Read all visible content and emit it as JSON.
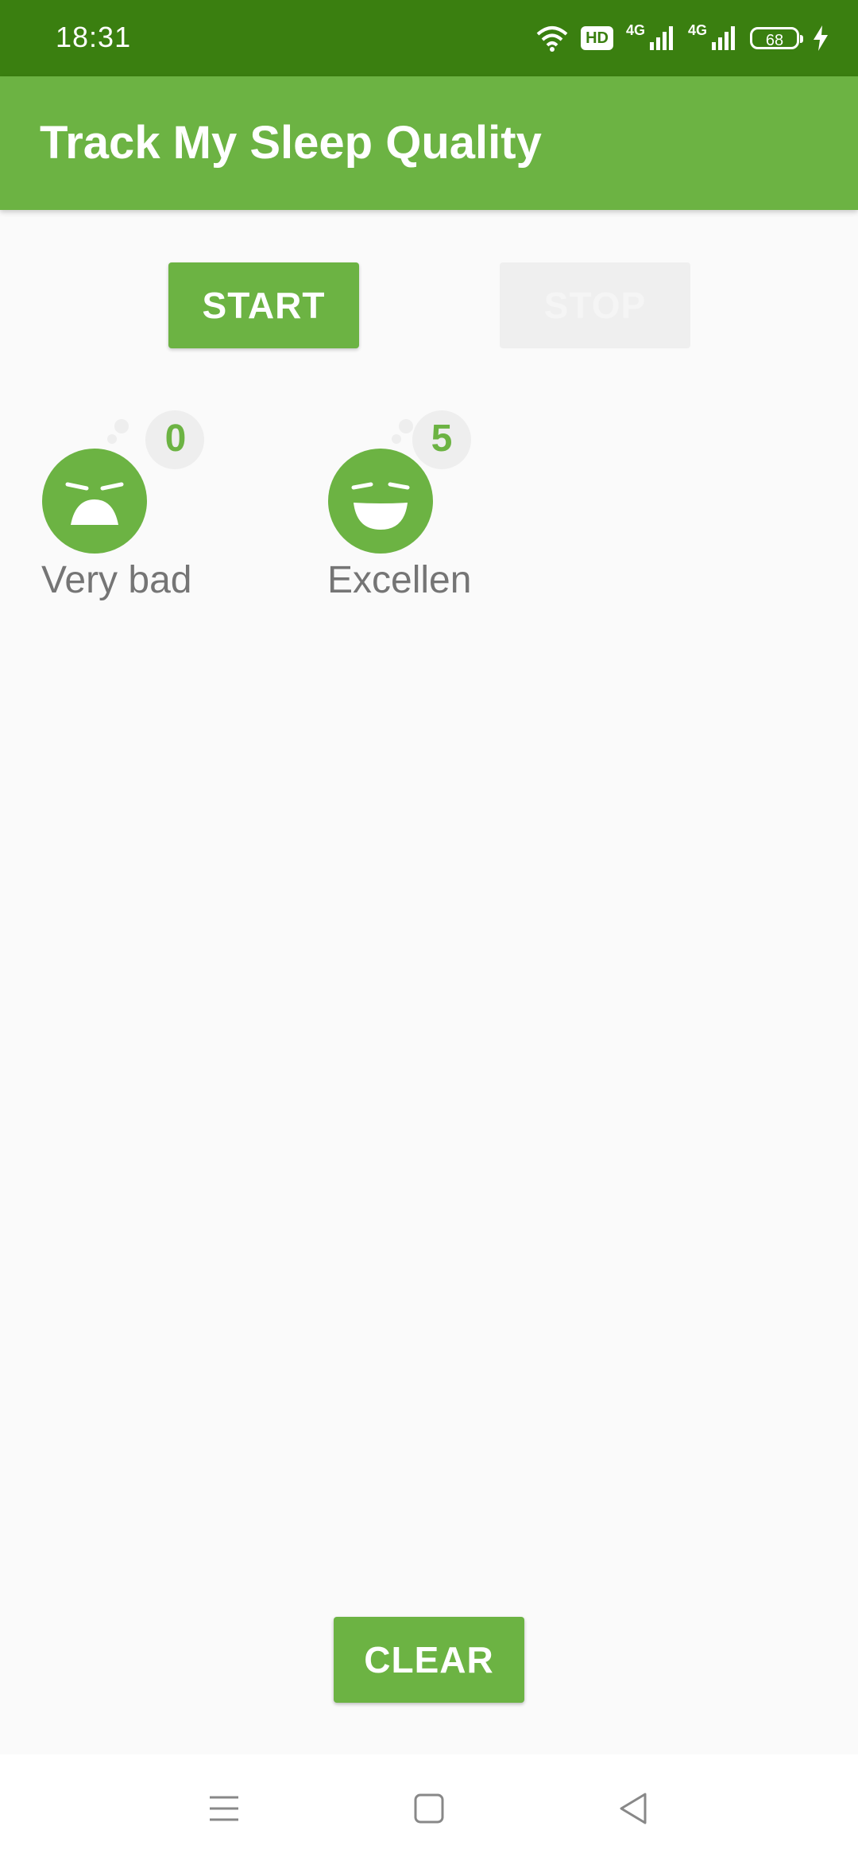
{
  "status_bar": {
    "time": "18:31",
    "hd_label": "HD",
    "network_1": "4G",
    "network_2": "4G",
    "battery_level": "68"
  },
  "app_bar": {
    "title": "Track My Sleep Quality"
  },
  "controls": {
    "start_label": "START",
    "stop_label": "STOP",
    "clear_label": "CLEAR"
  },
  "nights": [
    {
      "quality_label": "Very bad",
      "night_id": "0",
      "icon": "sleep-very-bad-icon"
    },
    {
      "quality_label": "Excellen",
      "night_id": "5",
      "icon": "sleep-excellent-icon"
    }
  ],
  "colors": {
    "primary": "#6cb343",
    "primary_dark": "#3a7f10",
    "label_gray": "#757575"
  }
}
